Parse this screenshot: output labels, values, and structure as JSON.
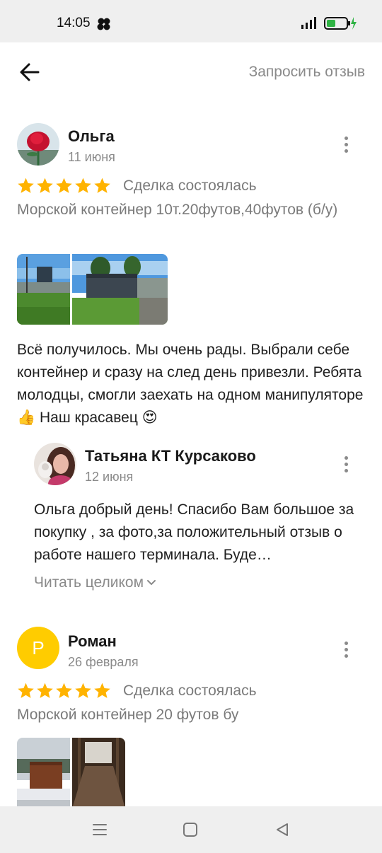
{
  "status": {
    "time": "14:05",
    "network": "4G",
    "battery_color": "#2fb344"
  },
  "header": {
    "request_review": "Запросить отзыв"
  },
  "reviews": [
    {
      "author": "Ольга",
      "date": "11 июня",
      "rating": 5,
      "deal_status": "Сделка состоялась",
      "product": "Морской контейнер 10т.20футов,40футов (б/у)",
      "text": "Всё получилось. Мы очень рады. Выбрали себе контейнер и сразу на след день привезли. Ребята молодцы, смогли заехать на одном манипуляторе👍 Наш красавец 😍",
      "reply": {
        "author": "Татьяна  КТ Курсаково",
        "date": "12 июня",
        "text": "Ольга добрый день! Спасибо Вам большое за покупку , за фото,за положительный отзыв о  работе нашего терминала. Буде…",
        "read_more": "Читать целиком"
      }
    },
    {
      "author": "Роман",
      "avatar_letter": "Р",
      "avatar_color": "#ffcc00",
      "date": "26 февраля",
      "rating": 5,
      "deal_status": "Сделка состоялась",
      "product": "Морской контейнер 20 футов бу"
    }
  ],
  "colors": {
    "star": "#ffb300",
    "accent_text": "#8a8a8a"
  }
}
